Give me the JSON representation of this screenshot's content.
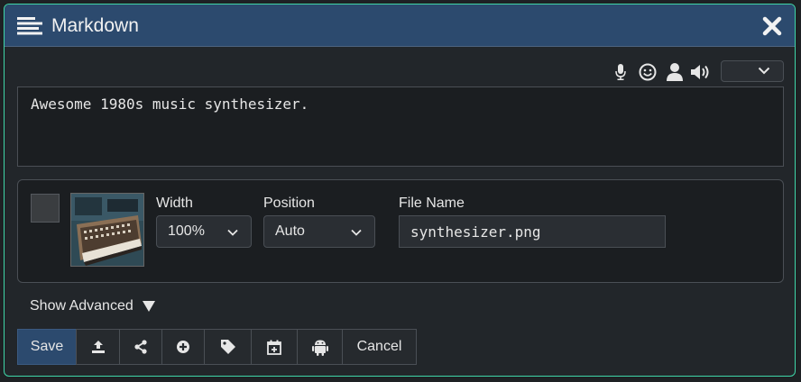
{
  "dialog": {
    "title": "Markdown",
    "title_icon": "align-left-icon",
    "close_icon": "close-icon",
    "accent_color": "#3fd6a8",
    "titlebar_color": "#2c4a6e"
  },
  "toolbar": {
    "icons": [
      "microphone-icon",
      "smiley-icon",
      "user-icon",
      "speaker-icon"
    ],
    "language_select_value": ""
  },
  "editor": {
    "text": "Awesome 1980s music synthesizer."
  },
  "media": {
    "width_label": "Width",
    "width_value": "100%",
    "position_label": "Position",
    "position_value": "Auto",
    "filename_label": "File Name",
    "filename_value": "synthesizer.png"
  },
  "advanced": {
    "label": "Show Advanced"
  },
  "actions": {
    "save_label": "Save",
    "icons": [
      "upload-icon",
      "share-icon",
      "add-circle-icon",
      "tag-icon",
      "calendar-add-icon",
      "android-icon"
    ],
    "cancel_label": "Cancel"
  }
}
